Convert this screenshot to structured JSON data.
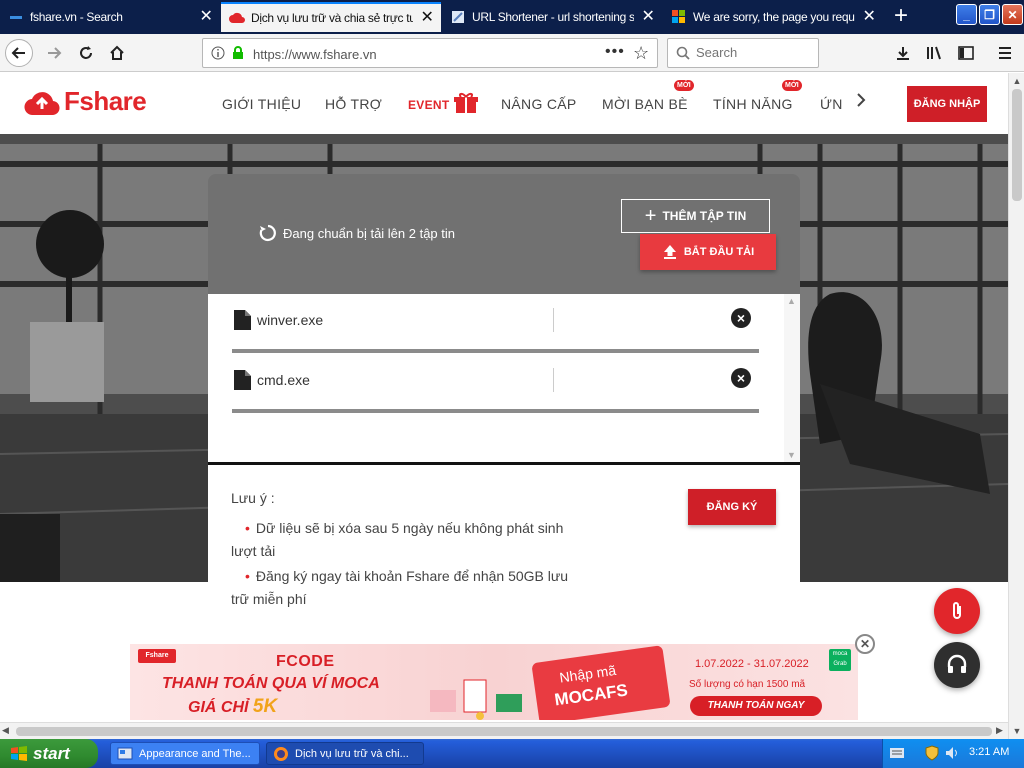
{
  "browser": {
    "tabs": [
      {
        "title": "fshare.vn - Search",
        "active": false
      },
      {
        "title": "Dịch vụ lưu trữ và chia sẻ trực tuyến",
        "active": true
      },
      {
        "title": "URL Shortener - url shortening service",
        "active": false
      },
      {
        "title": "We are sorry, the page you requested",
        "active": false
      }
    ],
    "url": "https://www.fshare.vn",
    "search_placeholder": "Search"
  },
  "site": {
    "logo": "Fshare",
    "menu": [
      {
        "label": "GIỚI THIỆU"
      },
      {
        "label": "HỖ TRỢ"
      },
      {
        "label": "EVENT"
      },
      {
        "label": "NÂNG CẤP"
      },
      {
        "label": "MỜI BẠN BÈ",
        "badge": "MỚI"
      },
      {
        "label": "TÍNH NĂNG",
        "badge": "MỚI"
      },
      {
        "label": "ỨNG DỤNG"
      }
    ],
    "login": "ĐĂNG NHẬP"
  },
  "upload": {
    "status": "Đang chuẩn bị tải lên 2 tập tin",
    "add_files": "THÊM TẬP TIN",
    "start_upload": "BẮT ĐẦU TẢI",
    "files": [
      {
        "name": "winver.exe"
      },
      {
        "name": "cmd.exe"
      }
    ]
  },
  "notes": {
    "title": "Lưu ý :",
    "items": [
      "Dữ liệu sẽ bị xóa sau 5 ngày nếu không phát sinh lượt tải",
      "Đăng ký ngay tài khoản Fshare để nhận 50GB lưu trữ miễn phí"
    ],
    "register": "ĐĂNG KÝ"
  },
  "banner": {
    "logo": "Fshare",
    "fcode": "FCODE",
    "line1": "THANH TOÁN QUA VÍ MOCA",
    "line2_prefix": "GIÁ CHỈ",
    "price": "5K",
    "coupon_top": "Nhập mã",
    "coupon_code": "MOCAFS",
    "dates": "1.07.2022 - 31.07.2022",
    "limit": "Số lượng có hạn 1500 mã",
    "pay_now": "THANH TOÁN NGAY",
    "moca": "moca Grab"
  },
  "taskbar": {
    "start": "start",
    "tasks": [
      {
        "label": "Appearance and The..."
      },
      {
        "label": "Dịch vụ lưu trữ và chi..."
      }
    ],
    "clock": "3:21 AM"
  },
  "colors": {
    "brand_red": "#e1262b",
    "tab_bar": "#0c1f4a",
    "panel_gray": "#717171"
  }
}
